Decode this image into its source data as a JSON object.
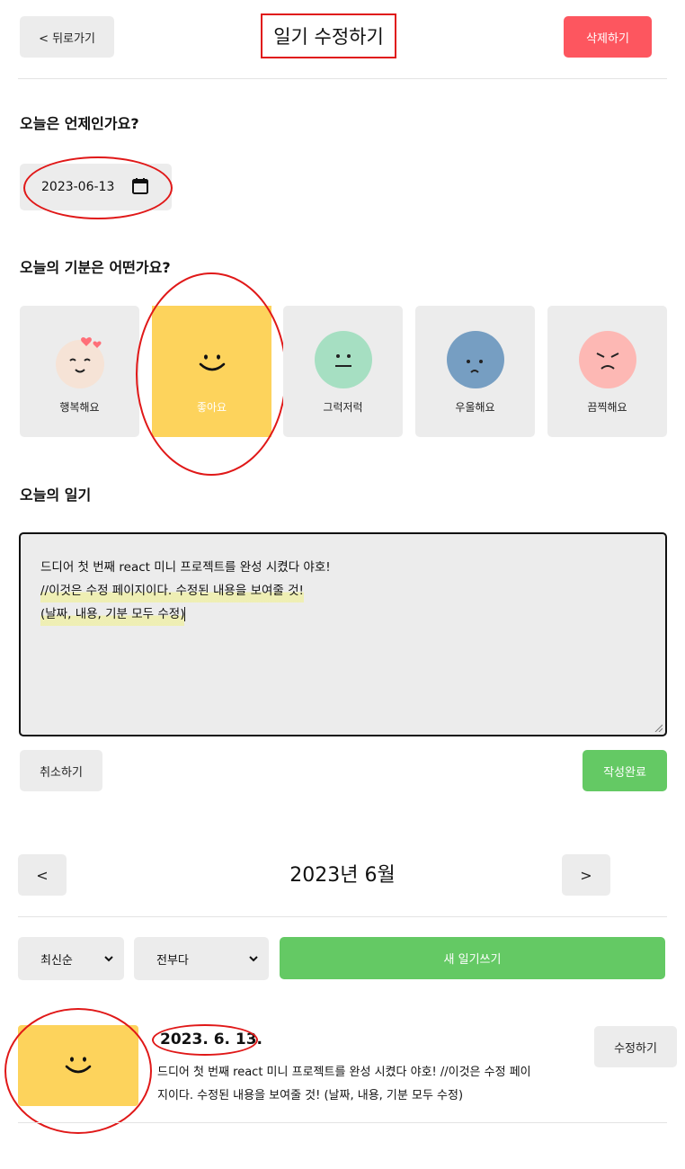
{
  "header": {
    "back_label": "< 뒤로가기",
    "title": "일기 수정하기",
    "delete_label": "삭제하기"
  },
  "date_section": {
    "title": "오늘은 언제인가요?",
    "value": "2023-06-13"
  },
  "emotion_section": {
    "title": "오늘의 기분은 어떤가요?",
    "items": [
      {
        "label": "행복해요",
        "icon": "happy-face-icon",
        "selected": false
      },
      {
        "label": "좋아요",
        "icon": "smile-face-icon",
        "selected": true
      },
      {
        "label": "그럭저럭",
        "icon": "neutral-face-icon",
        "selected": false
      },
      {
        "label": "우울해요",
        "icon": "sad-face-icon",
        "selected": false
      },
      {
        "label": "끔찍해요",
        "icon": "angry-face-icon",
        "selected": false
      }
    ]
  },
  "diary_section": {
    "title": "오늘의 일기",
    "lines": [
      "드디어 첫 번째 react 미니 프로젝트를 완성 시켰다 야호!",
      "",
      "//이것은 수정 페이지이다. 수정된 내용을 보여줄 것!",
      "(날짜, 내용, 기분 모두 수정)"
    ]
  },
  "form_actions": {
    "cancel_label": "취소하기",
    "submit_label": "작성완료"
  },
  "list_header": {
    "prev_label": "<",
    "month_title": "2023년 6월",
    "next_label": ">"
  },
  "list_controls": {
    "sort_value": "최신순",
    "filter_value": "전부다",
    "new_label": "새 일기쓰기"
  },
  "list_item": {
    "date": "2023. 6. 13.",
    "content_line1": "드디어 첫 번째 react 미니 프로젝트를 완성 시켰다 야호! //이것은 수정 페이",
    "content_line2": "지이다. 수정된 내용을 보여줄 것! (날짜, 내용, 기분 모두 수정)",
    "edit_label": "수정하기"
  },
  "colors": {
    "accent_red": "#fd565f",
    "accent_green": "#64c964",
    "selected_emotion": "#fdd35c",
    "annotation_red": "#e01818"
  }
}
